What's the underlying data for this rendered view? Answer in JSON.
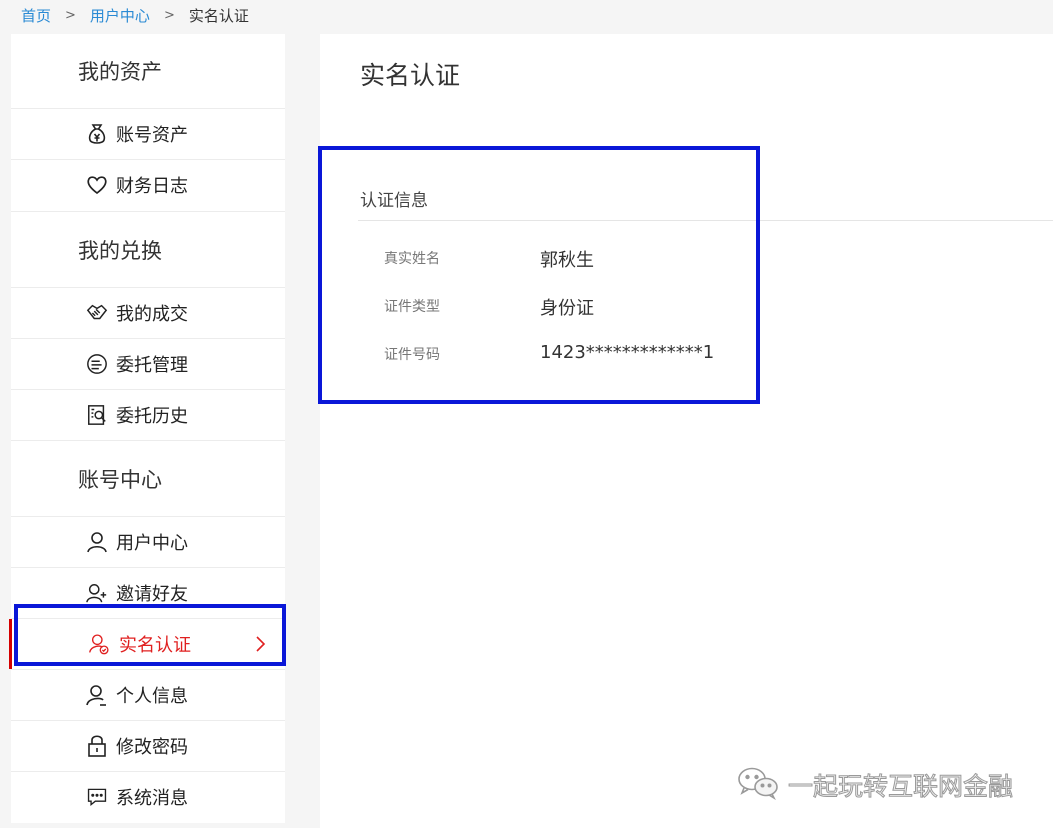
{
  "breadcrumb": {
    "home": "首页",
    "user_center": "用户中心",
    "current": "实名认证",
    "separator": ">"
  },
  "sidebar": {
    "sections": [
      {
        "title": "我的资产"
      },
      {
        "title": "我的兑换"
      },
      {
        "title": "账号中心"
      }
    ],
    "items": [
      {
        "label": "账号资产",
        "icon": "money-bag-icon"
      },
      {
        "label": "财务日志",
        "icon": "heart-icon"
      },
      {
        "label": "我的成交",
        "icon": "handshake-icon"
      },
      {
        "label": "委托管理",
        "icon": "coin-stack-icon"
      },
      {
        "label": "委托历史",
        "icon": "history-search-icon"
      },
      {
        "label": "用户中心",
        "icon": "user-icon"
      },
      {
        "label": "邀请好友",
        "icon": "add-user-icon"
      },
      {
        "label": "实名认证",
        "icon": "verified-user-icon",
        "active": true
      },
      {
        "label": "个人信息",
        "icon": "user-edit-icon"
      },
      {
        "label": "修改密码",
        "icon": "lock-icon"
      },
      {
        "label": "系统消息",
        "icon": "chat-icon"
      }
    ],
    "active_color": "#e02020"
  },
  "main": {
    "title": "实名认证",
    "section_title": "认证信息",
    "rows": [
      {
        "key": "真实姓名",
        "value": "郭秋生"
      },
      {
        "key": "证件类型",
        "value": "身份证"
      },
      {
        "key": "证件号码",
        "value": "1423*************1"
      }
    ]
  },
  "watermark": {
    "text": "一起玩转互联网金融",
    "icon": "wechat-icon"
  },
  "colors": {
    "highlight_box": "#0a17d8",
    "breadcrumb_link": "#2a8ad4"
  }
}
